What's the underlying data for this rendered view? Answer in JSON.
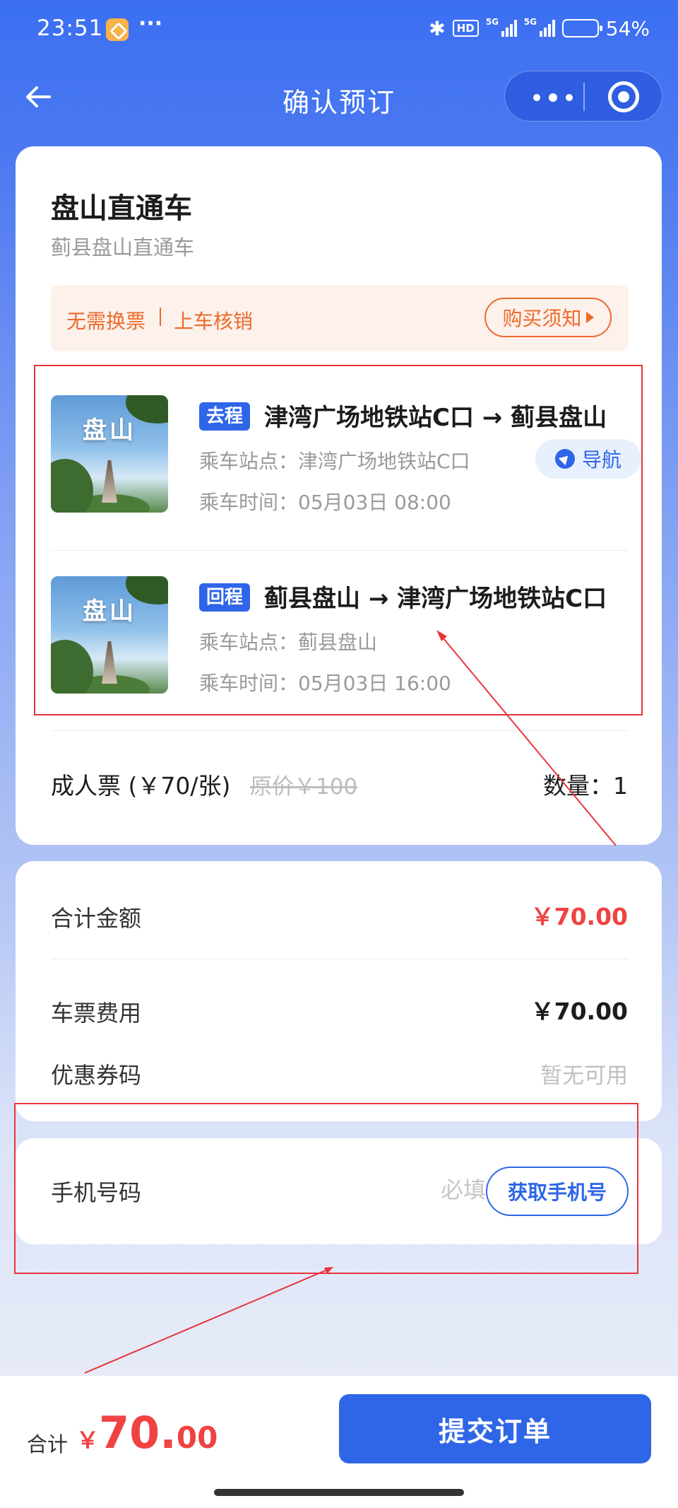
{
  "status_bar": {
    "time": "23:51",
    "more": "···",
    "hd": "HD",
    "net1": "5G",
    "net2": "5G",
    "battery_percent": "54%",
    "battery_level": 0.54
  },
  "nav": {
    "title": "确认预订"
  },
  "product": {
    "title": "盘山直通车",
    "subtitle": "蓟县盘山直通车",
    "notice_left": "无需换票",
    "notice_right": "上车核销",
    "rules_button": "购买须知",
    "thumb_text": "盘山"
  },
  "trips": [
    {
      "tag": "去程",
      "route": "津湾广场地铁站C口 → 蓟县盘山",
      "station": "乘车站点：津湾广场地铁站C口",
      "time": "乘车时间：05月03日 08:00",
      "nav_button": "导航"
    },
    {
      "tag": "回程",
      "route": "蓟县盘山 → 津湾广场地铁站C口",
      "station": "乘车站点：蓟县盘山",
      "time": "乘车时间：05月03日 16:00"
    }
  ],
  "ticket": {
    "label": "成人票 (￥70/张)",
    "original_price": "原价￥100",
    "quantity": "数量：1"
  },
  "summary": {
    "total_label": "合计金额",
    "total_value": "￥70.00",
    "fee_label": "车票费用",
    "fee_value": "￥70.00",
    "coupon_label": "优惠券码",
    "coupon_value": "暂无可用"
  },
  "phone": {
    "label": "手机号码",
    "placeholder": "必填",
    "button": "获取手机号"
  },
  "bottom": {
    "total_label": "合计",
    "currency": "￥",
    "price_int": "70.",
    "price_dec": "00",
    "submit": "提交订单"
  },
  "colors": {
    "primary": "#2f66e8",
    "price_red": "#ef4343",
    "notice_orange": "#ec6a2a",
    "annotation_red": "#e8353b"
  }
}
